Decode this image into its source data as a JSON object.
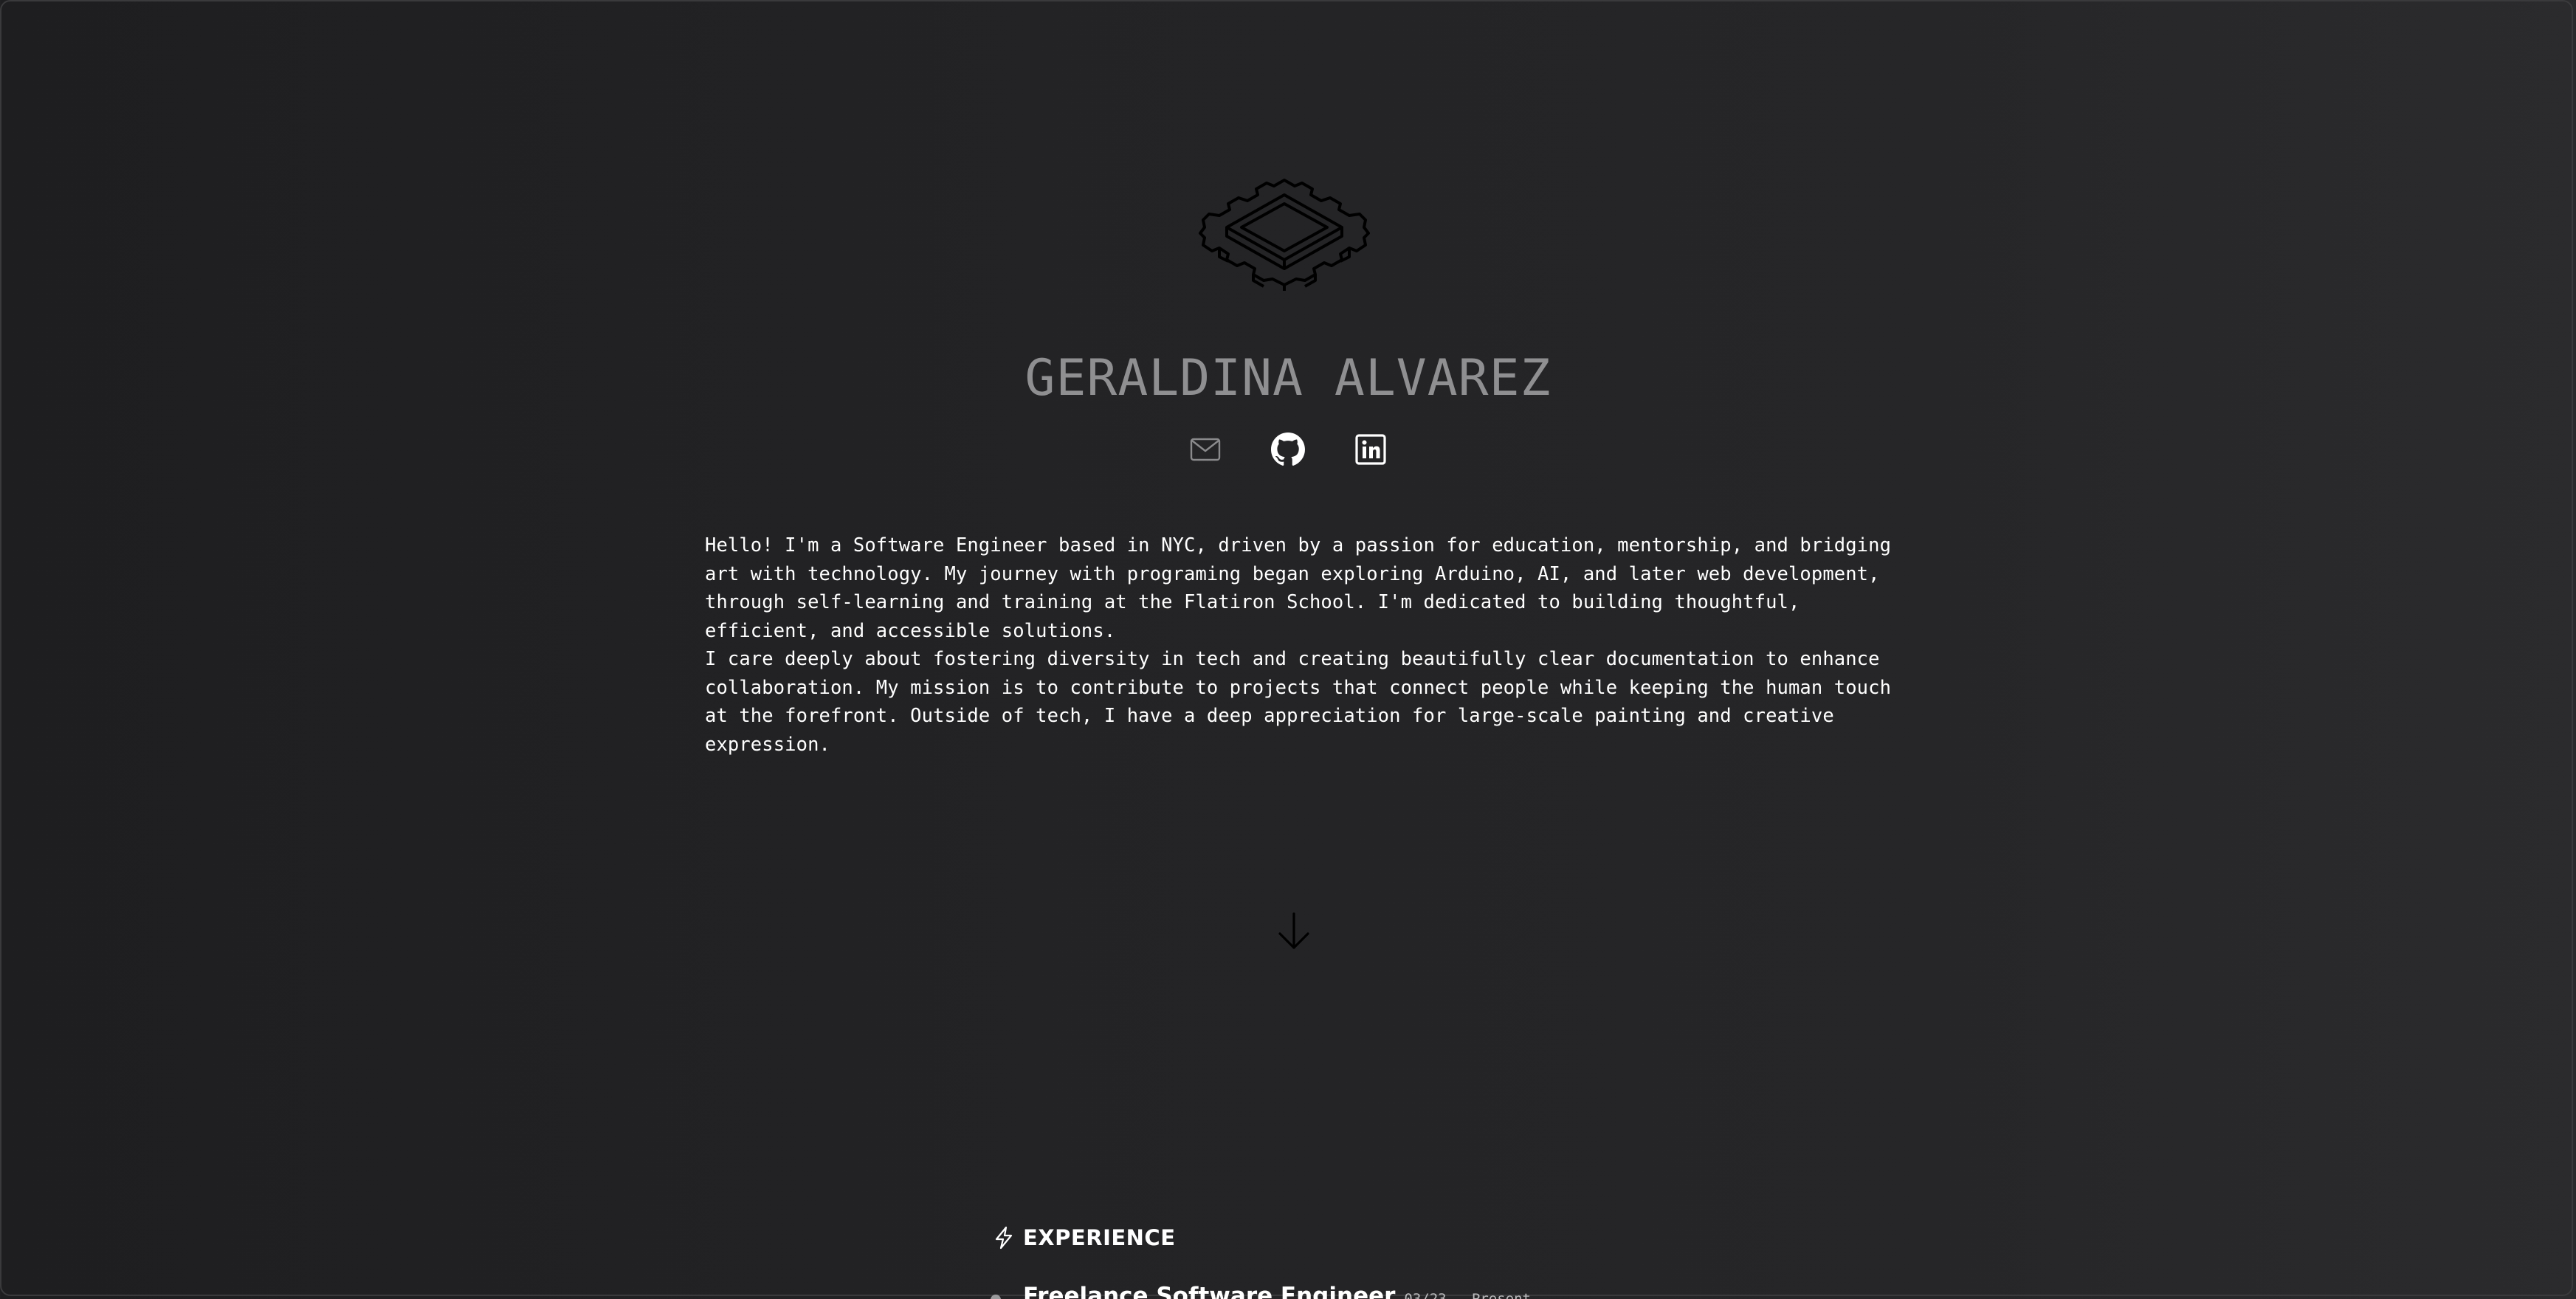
{
  "profile": {
    "name": "GERALDINA ALVAREZ",
    "logo_icon": "microchip-icon"
  },
  "socials": [
    {
      "icon": "mail-icon",
      "label": "Email",
      "color": "#8a8a8c"
    },
    {
      "icon": "github-icon",
      "label": "GitHub",
      "color": "#ffffff"
    },
    {
      "icon": "linkedin-icon",
      "label": "LinkedIn",
      "color": "#ffffff"
    }
  ],
  "bio": {
    "paragraph_1": "Hello! I'm a Software Engineer based in NYC, driven by a passion for education, mentorship, and bridging art with technology. My journey with programing began exploring Arduino, AI, and later web development, through self-learning and training at the Flatiron School. I'm dedicated to building thoughtful, efficient, and accessible solutions.",
    "paragraph_2": "I care deeply about fostering diversity in tech and creating beautifully clear documentation to enhance collaboration. My mission is to contribute to projects that connect people while keeping the human touch at the forefront. Outside of tech, I have a deep appreciation for large-scale painting and creative expression."
  },
  "scroll": {
    "icon": "arrow-down-icon"
  },
  "experience": {
    "icon": "lightning-icon",
    "title": "EXPERIENCE",
    "jobs": [
      {
        "title": "Freelance Software Engineer",
        "dates": "03/23 – Present"
      }
    ]
  },
  "colors": {
    "background": "#232325",
    "name_text": "#8f8f91",
    "body_text": "#ffffff"
  }
}
